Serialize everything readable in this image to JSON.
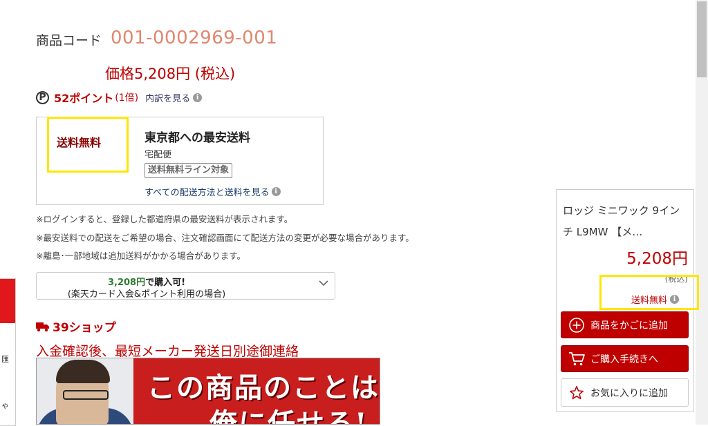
{
  "product": {
    "code_label": "商品コード",
    "code_value": "001-0002969-001",
    "price": "価格5,208円 (税込)"
  },
  "points": {
    "icon_letter": "P",
    "value": "52ポイント",
    "multiplier": "(1倍)",
    "breakdown_link": "内訳を見る"
  },
  "shipping": {
    "free_label": "送料無料",
    "title": "東京都への最安送料",
    "method": "宅配便",
    "badge": "送料無料ライン対象",
    "all_methods_link": "すべての配送方法と送料を見る"
  },
  "notes": [
    "※ログインすると、登録した都道府県の最安送料が表示されます。",
    "※最安送料での配送をご希望の場合、注文確認画面にて配送方法の変更が必要な場合があります。",
    "※離島･一部地域は追加送料がかかる場合があります。"
  ],
  "card_offer": {
    "amount": "3,208円",
    "line1_suffix": "で購入可!",
    "line2": "(楽天カード入会&ポイント利用の場合)"
  },
  "shop": {
    "name": "39ショップ",
    "shipping_info": "入金確認後、最短メーカー発送日別途御連絡"
  },
  "banner": {
    "line1": "この商品のことは",
    "line2": "俺に任せろ!"
  },
  "left_sliver": {
    "chars": [
      "匯",
      "ゃ"
    ]
  },
  "side_panel": {
    "title": "ロッジ ミニワック 9インチ L9MW 【メ…",
    "price": "5,208円",
    "tax": "(税込)",
    "free_shipping": "送料無料",
    "add_to_cart": "商品をかごに追加",
    "checkout": "ご購入手続きへ",
    "favorite": "お気に入りに追加"
  },
  "colors": {
    "accent_red": "#bf0000",
    "highlight_yellow": "#ffe600",
    "code_orange": "#e0876f",
    "card_green": "#2e7d32"
  },
  "icons": [
    "p-circle-icon",
    "info-icon",
    "chevron-down-icon",
    "truck-icon",
    "plus-circle-icon",
    "cart-icon",
    "star-icon"
  ]
}
